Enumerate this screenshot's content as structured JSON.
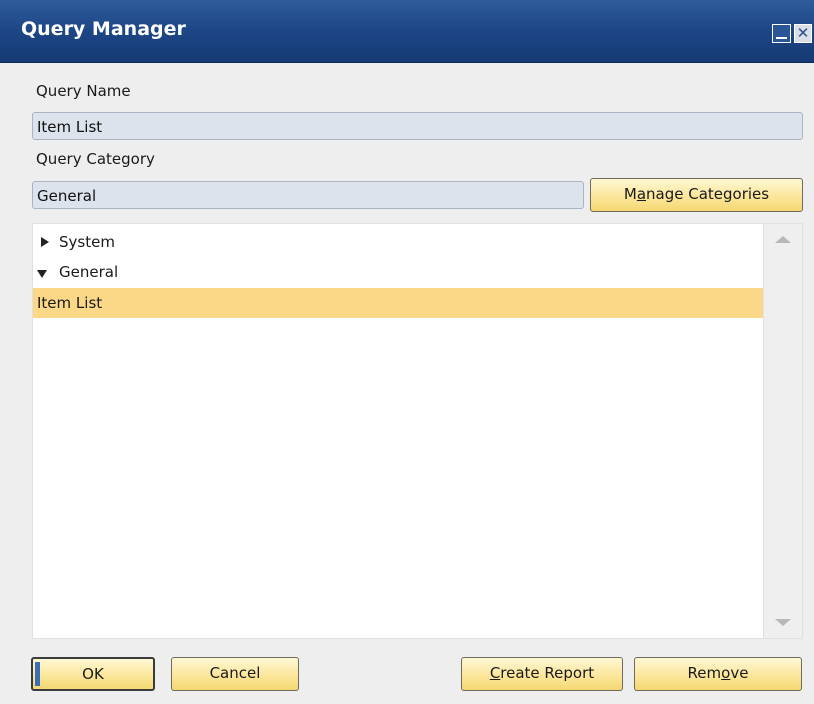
{
  "window": {
    "title": "Query Manager",
    "minimize_icon": "minimize-icon",
    "close_icon": "close-icon",
    "close_glyph": "✕"
  },
  "form": {
    "query_name_label": "Query Name",
    "query_name_value": "Item List",
    "query_category_label": "Query Category",
    "query_category_value": "General",
    "manage_categories_prefix": "M",
    "manage_categories_underlined": "a",
    "manage_categories_rest": "nage Categories"
  },
  "tree": {
    "items": [
      {
        "label": "System",
        "expanded": false,
        "icon": "caret-right-icon"
      },
      {
        "label": "General",
        "expanded": true,
        "icon": "caret-down-icon"
      },
      {
        "label": "Item List",
        "selected": true
      }
    ]
  },
  "footer": {
    "ok_label": "OK",
    "cancel_label": "Cancel",
    "create_report_underlined": "C",
    "create_report_rest": "reate Report",
    "remove_prefix": "Rem",
    "remove_underlined": "o",
    "remove_rest": "ve"
  },
  "colors": {
    "titlebar": "#1d4686",
    "button_fill": "#fbe69b",
    "selection": "#fbd887",
    "field_fill": "#dde3ec"
  }
}
